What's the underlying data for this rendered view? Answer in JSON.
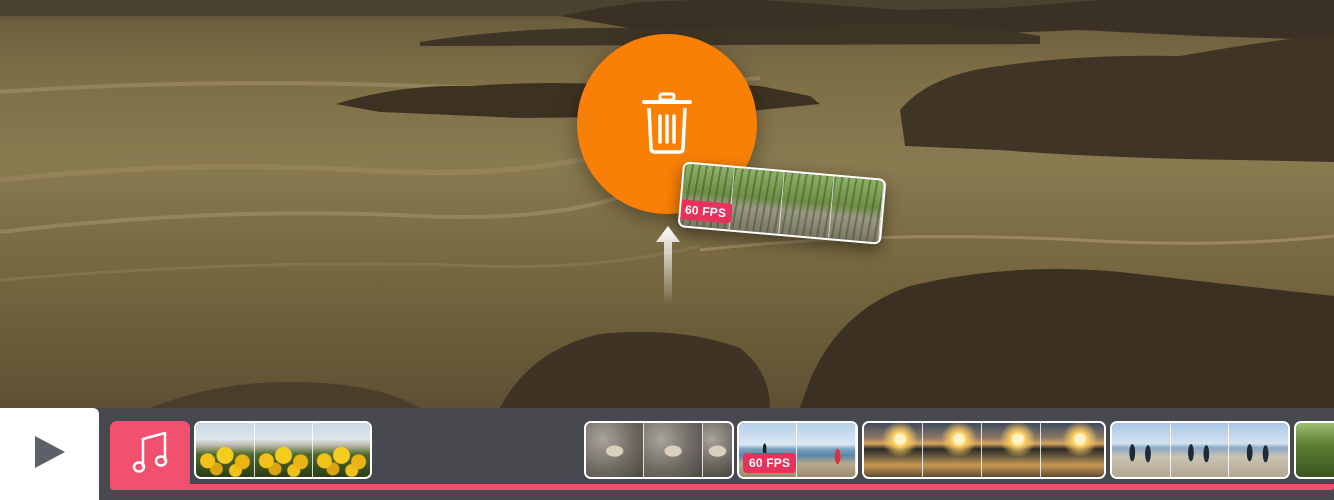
{
  "scene": {
    "description_icon": "beach-background"
  },
  "trash": {
    "icon": "trash-icon",
    "color": "#fa8005"
  },
  "dragged_clip": {
    "badge": "60 FPS",
    "badge_color": "#e8325c"
  },
  "drag_arrow": {
    "icon": "arrow-up-icon"
  },
  "toolbar": {
    "play_icon": "play-icon",
    "music_icon": "music-note-icon",
    "accent_color": "#f1506e",
    "background_color": "#47494e"
  },
  "timeline": {
    "clips": [
      {
        "id": "clip-flowers"
      },
      {
        "id": "clip-shells"
      },
      {
        "id": "clip-beach-red",
        "badge": "60 FPS"
      },
      {
        "id": "clip-sunset"
      },
      {
        "id": "clip-surfers"
      },
      {
        "id": "clip-green"
      }
    ]
  }
}
